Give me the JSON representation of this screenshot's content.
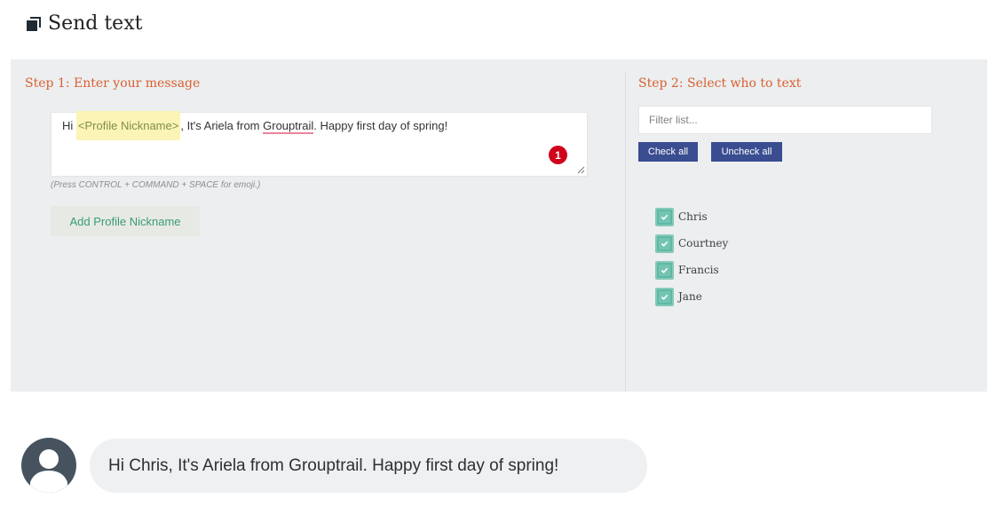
{
  "header": {
    "title": "Send text",
    "icon": "stacked-copies-icon"
  },
  "step1": {
    "title": "Step 1: Enter your message",
    "message": {
      "prefix": "Hi ",
      "token": "<Profile Nickname>",
      "middle": ", It's Ariela from ",
      "underlined_word": "Grouptrail",
      "suffix": ". Happy first day of spring!"
    },
    "badge_count": "1",
    "emoji_hint": "(Press CONTROL + COMMAND + SPACE for emoji.)",
    "add_nickname_label": "Add Profile Nickname"
  },
  "step2": {
    "title": "Step 2: Select who to text",
    "filter_placeholder": "Filter list...",
    "check_all_label": "Check all",
    "uncheck_all_label": "Uncheck all",
    "contacts": [
      {
        "name": "Chris",
        "checked": true
      },
      {
        "name": "Courtney",
        "checked": true
      },
      {
        "name": "Francis",
        "checked": true
      },
      {
        "name": "Jane",
        "checked": true
      }
    ]
  },
  "preview": {
    "text": "Hi Chris, It's Ariela from Grouptrail. Happy first day of spring!",
    "avatar_icon": "person-icon"
  },
  "colors": {
    "accent_orange": "#d8602e",
    "button_blue": "#3a4d91",
    "check_teal": "#5fb8a6",
    "badge_red": "#d0021b",
    "token_highlight": "#fbf4b6"
  }
}
